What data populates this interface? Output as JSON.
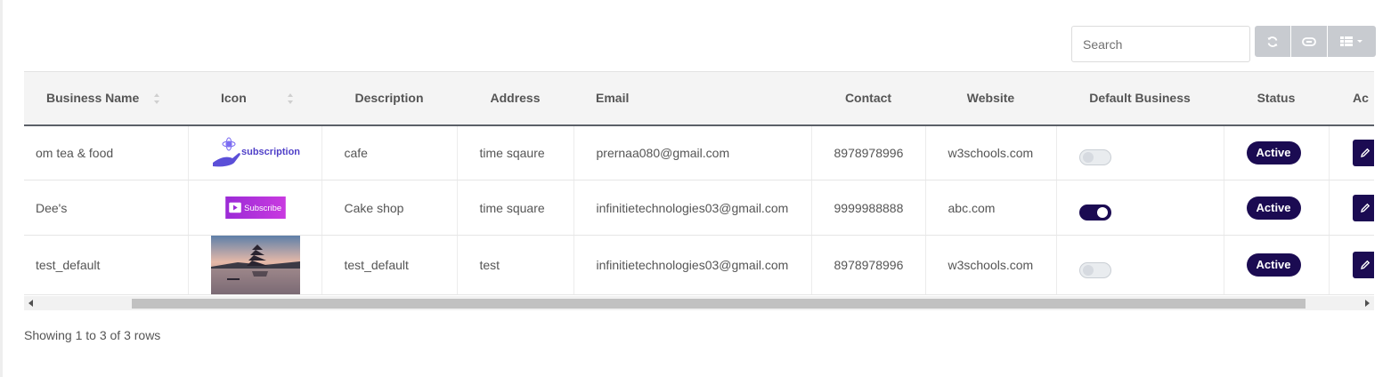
{
  "search": {
    "placeholder": "Search",
    "value": ""
  },
  "toolbar": {
    "refresh_icon": "refresh-icon",
    "toggle_icon": "toggle-view-icon",
    "columns_icon": "columns-icon"
  },
  "table": {
    "headers": [
      "Business Name",
      "Icon",
      "Description",
      "Address",
      "Email",
      "Contact",
      "Website",
      "Default Business",
      "Status",
      "Ac"
    ],
    "rows": [
      {
        "name": "om tea & food",
        "icon": "subscription",
        "description": "cafe",
        "address": "time sqaure",
        "email": "prernaa080@gmail.com",
        "contact": "8978978996",
        "website": "w3schools.com",
        "default": false,
        "status": "Active"
      },
      {
        "name": "Dee's",
        "icon": "Subscribe",
        "description": "Cake shop",
        "address": "time square",
        "email": "infinitietechnologies03@gmail.com",
        "contact": "9999988888",
        "website": "abc.com",
        "default": true,
        "status": "Active"
      },
      {
        "name": "test_default",
        "icon": "pagoda-photo",
        "description": "test_default",
        "address": "test",
        "email": "infinitietechnologies03@gmail.com",
        "contact": "8978978996",
        "website": "w3schools.com",
        "default": false,
        "status": "Active"
      }
    ]
  },
  "footer": {
    "info": "Showing 1 to 3 of 3 rows"
  },
  "colors": {
    "accent": "#1b0b52",
    "toolbar_button": "#c8cbd0",
    "header_bg": "#f4f4f4"
  }
}
